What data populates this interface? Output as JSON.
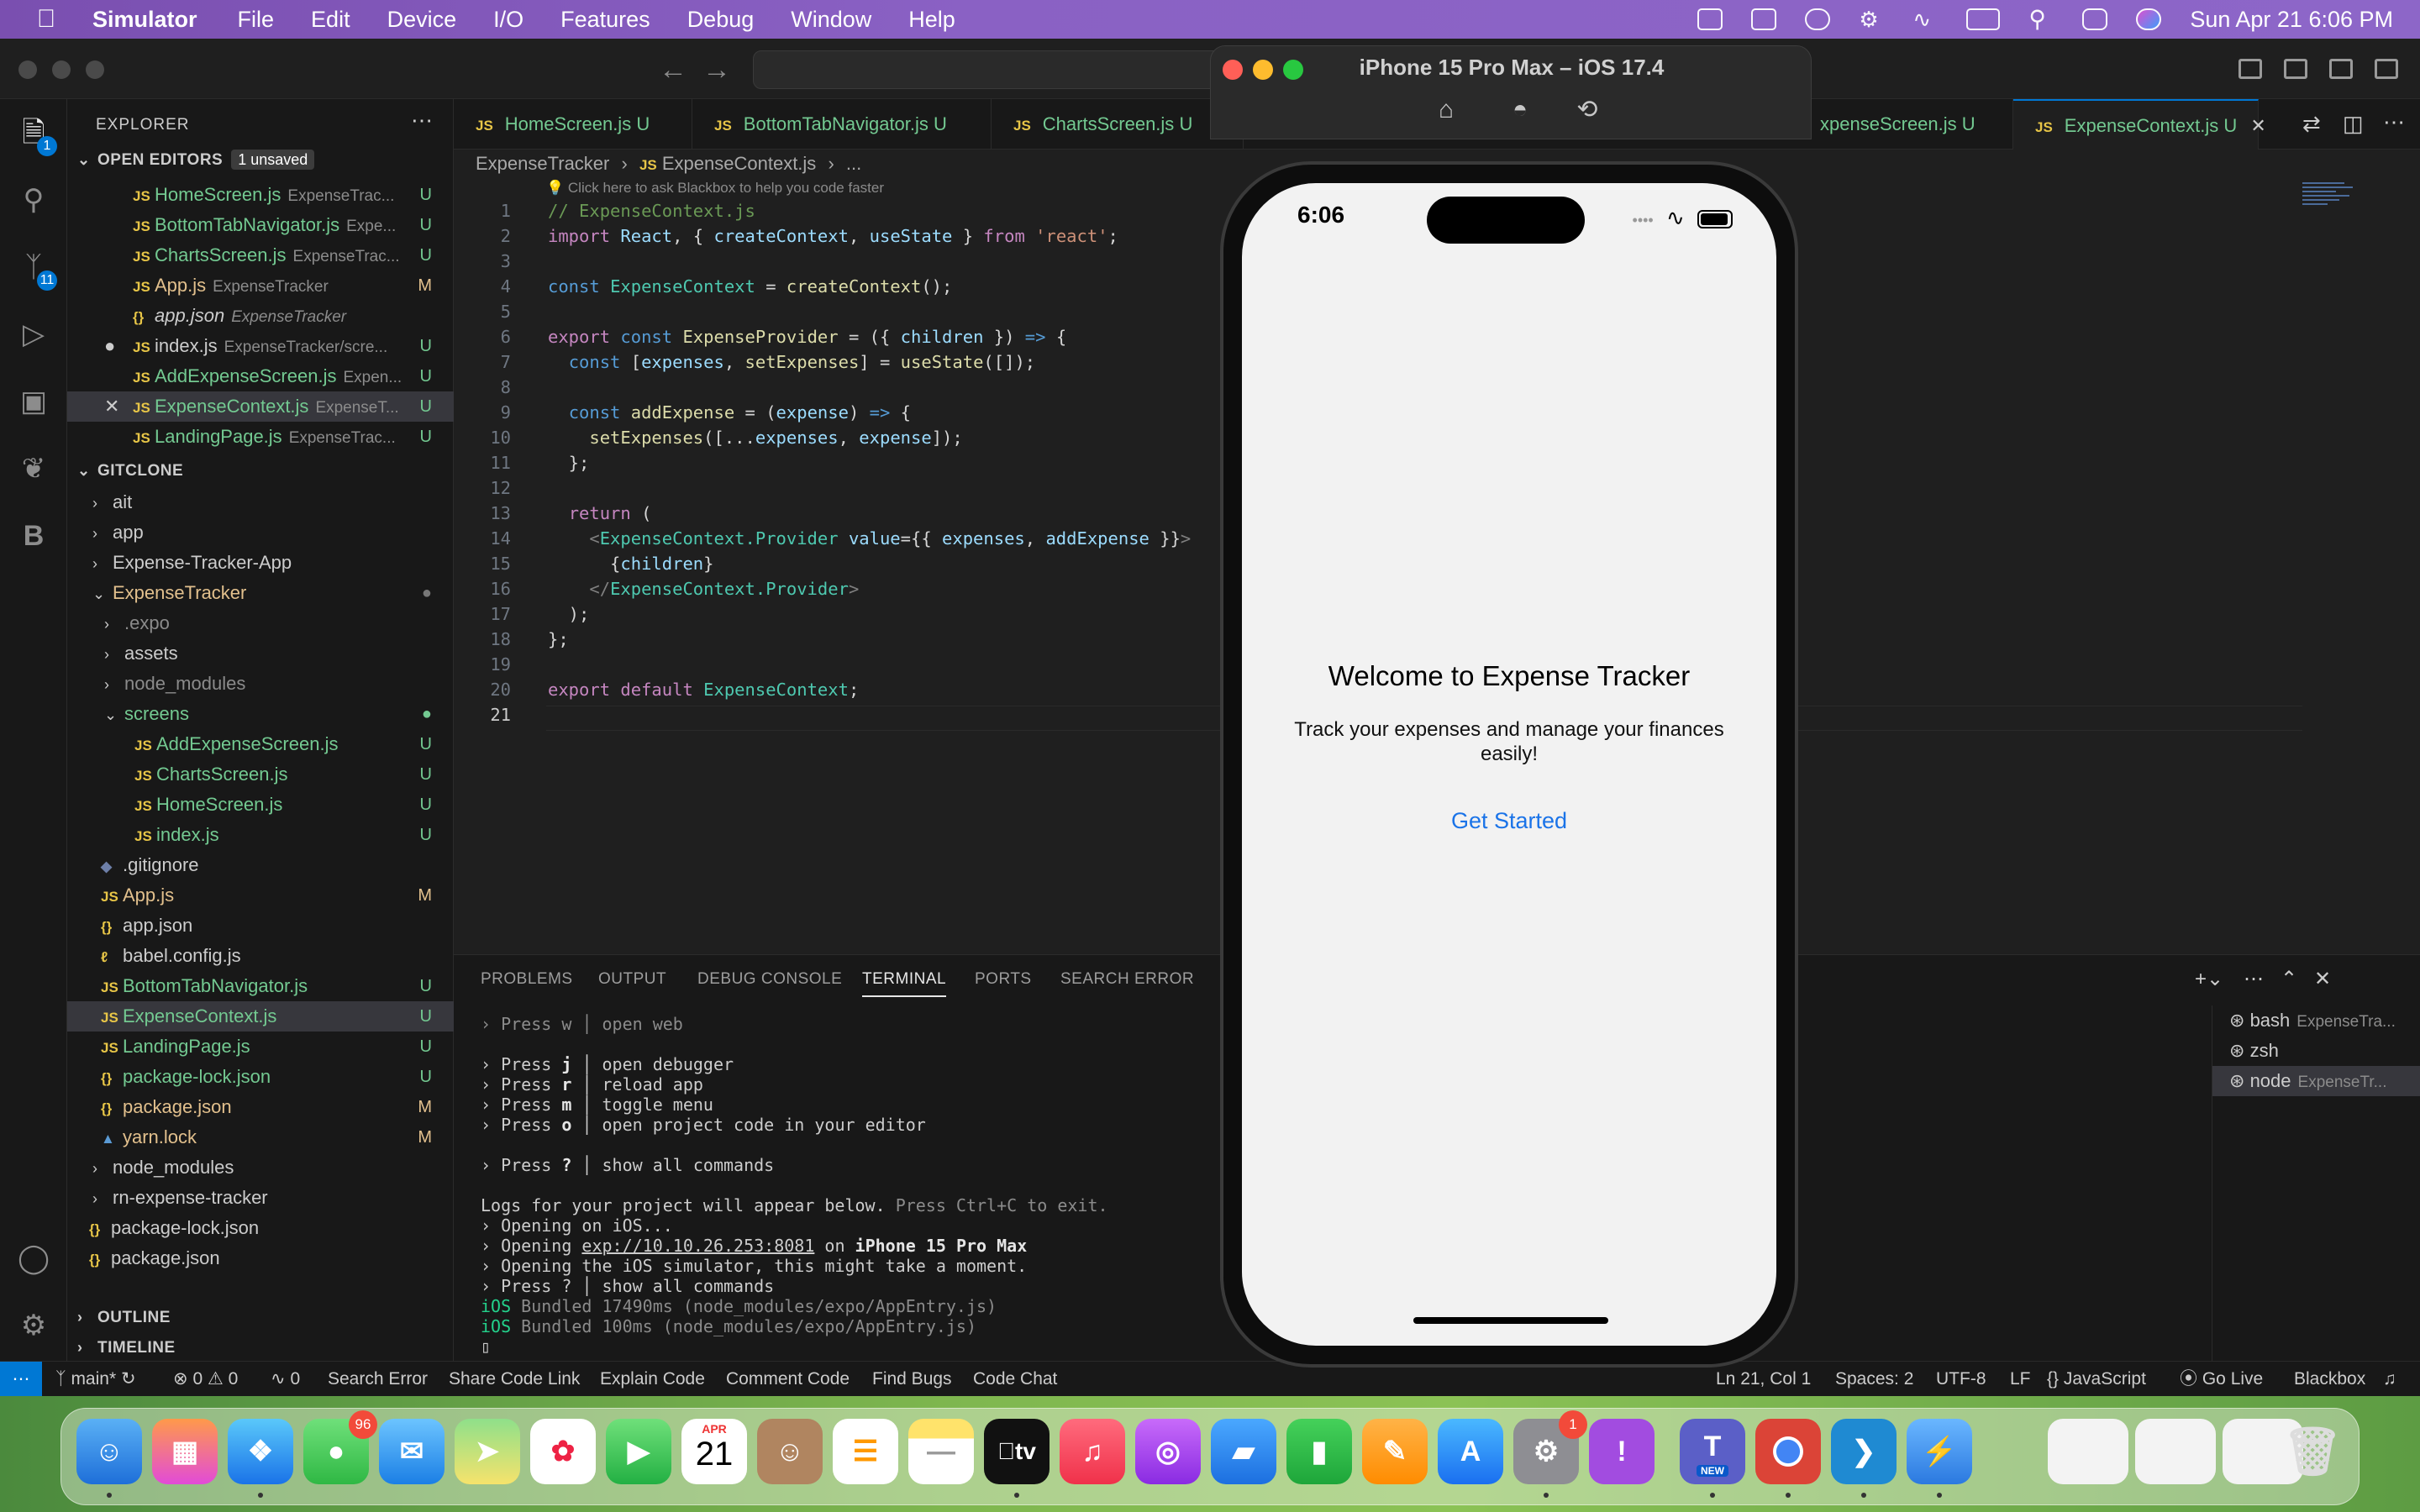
{
  "menubar": {
    "app": "Simulator",
    "items": [
      "File",
      "Edit",
      "Device",
      "I/O",
      "Features",
      "Debug",
      "Window",
      "Help"
    ],
    "clock": "Sun Apr 21  6:06 PM"
  },
  "explorer": {
    "title": "EXPLORER",
    "open_editors_label": "OPEN EDITORS",
    "unsaved_badge": "1 unsaved",
    "open_editors": [
      {
        "icon": "JS",
        "name": "HomeScreen.js",
        "desc": "ExpenseTrac...",
        "status": "U"
      },
      {
        "icon": "JS",
        "name": "BottomTabNavigator.js",
        "desc": "Expe...",
        "status": "U"
      },
      {
        "icon": "JS",
        "name": "ChartsScreen.js",
        "desc": "ExpenseTrac...",
        "status": "U"
      },
      {
        "icon": "JS",
        "name": "App.js",
        "desc": "ExpenseTracker",
        "status": "M"
      },
      {
        "icon": "{}",
        "name": "app.json",
        "desc": "ExpenseTracker",
        "status": ""
      },
      {
        "icon": "JS",
        "name": "index.js",
        "desc": "ExpenseTracker/scre...",
        "status": "U"
      },
      {
        "icon": "JS",
        "name": "AddExpenseScreen.js",
        "desc": "Expen...",
        "status": "U"
      },
      {
        "icon": "JS",
        "name": "ExpenseContext.js",
        "desc": "ExpenseT...",
        "status": "U"
      },
      {
        "icon": "JS",
        "name": "LandingPage.js",
        "desc": "ExpenseTrac...",
        "status": "U"
      }
    ],
    "workspace_label": "GITCLONE",
    "tree": [
      {
        "name": "ait",
        "type": "folder"
      },
      {
        "name": "app",
        "type": "folder"
      },
      {
        "name": "Expense-Tracker-App",
        "type": "folder"
      },
      {
        "name": "ExpenseTracker",
        "type": "folder-open"
      },
      {
        "name": ".expo",
        "type": "folder"
      },
      {
        "name": "assets",
        "type": "folder"
      },
      {
        "name": "node_modules",
        "type": "folder"
      },
      {
        "name": "screens",
        "type": "folder-open"
      },
      {
        "name": "AddExpenseScreen.js",
        "status": "U"
      },
      {
        "name": "ChartsScreen.js",
        "status": "U"
      },
      {
        "name": "HomeScreen.js",
        "status": "U"
      },
      {
        "name": "index.js",
        "status": "U"
      },
      {
        "name": ".gitignore",
        "status": ""
      },
      {
        "name": "App.js",
        "status": "M"
      },
      {
        "name": "app.json",
        "status": ""
      },
      {
        "name": "babel.config.js",
        "status": ""
      },
      {
        "name": "BottomTabNavigator.js",
        "status": "U"
      },
      {
        "name": "ExpenseContext.js",
        "status": "U"
      },
      {
        "name": "LandingPage.js",
        "status": "U"
      },
      {
        "name": "package-lock.json",
        "status": "U"
      },
      {
        "name": "package.json",
        "status": "M"
      },
      {
        "name": "yarn.lock",
        "status": "M"
      },
      {
        "name": "node_modules",
        "type": "folder"
      },
      {
        "name": "rn-expense-tracker",
        "type": "folder"
      },
      {
        "name": "package-lock.json",
        "status": ""
      },
      {
        "name": "package.json",
        "status": ""
      }
    ],
    "outline_label": "OUTLINE",
    "timeline_label": "TIMELINE"
  },
  "tabs": [
    {
      "name": "HomeScreen.js",
      "status": "U"
    },
    {
      "name": "BottomTabNavigator.js",
      "status": "U"
    },
    {
      "name": "ChartsScreen.js",
      "status": "U"
    },
    {
      "name": "xpenseScreen.js",
      "status": "U"
    },
    {
      "name": "ExpenseContext.js",
      "status": "U"
    }
  ],
  "breadcrumb": {
    "folder": "ExpenseTracker",
    "file": "ExpenseContext.js",
    "more": "..."
  },
  "blackbox_hint": "Click here to ask Blackbox to help you code faster",
  "editor": {
    "line_numbers": [
      "1",
      "2",
      "3",
      "4",
      "5",
      "6",
      "7",
      "8",
      "9",
      "10",
      "11",
      "12",
      "13",
      "14",
      "15",
      "16",
      "17",
      "18",
      "19",
      "20",
      "21"
    ]
  },
  "panel": {
    "tabs": [
      "PROBLEMS",
      "OUTPUT",
      "DEBUG CONSOLE",
      "TERMINAL",
      "PORTS",
      "SEARCH ERROR"
    ],
    "terminals": [
      {
        "name": "bash",
        "desc": "ExpenseTra..."
      },
      {
        "name": "zsh",
        "desc": ""
      },
      {
        "name": "node",
        "desc": "ExpenseTr..."
      }
    ]
  },
  "statusbar": {
    "branch": "main*",
    "problems": "0 ⚠ 0",
    "ports": "0",
    "items_left": [
      "Search Error",
      "Share Code Link",
      "Explain Code",
      "Comment Code",
      "Find Bugs",
      "Code Chat"
    ],
    "cursor": "Ln 21, Col 1",
    "spaces": "Spaces: 2",
    "encoding": "UTF-8",
    "eol": "LF",
    "language": "JavaScript",
    "golive": "Go Live",
    "blackbox": "Blackbox"
  },
  "simulator": {
    "title": "iPhone 15 Pro Max – iOS 17.4",
    "time": "6:06",
    "welcome": "Welcome to Expense Tracker",
    "tagline": "Track your expenses and manage your finances easily!",
    "button": "Get Started"
  },
  "dock": {
    "messages_badge": "96",
    "settings_badge": "1",
    "calendar_month": "APR",
    "calendar_day": "21",
    "teams_label": "NEW"
  }
}
